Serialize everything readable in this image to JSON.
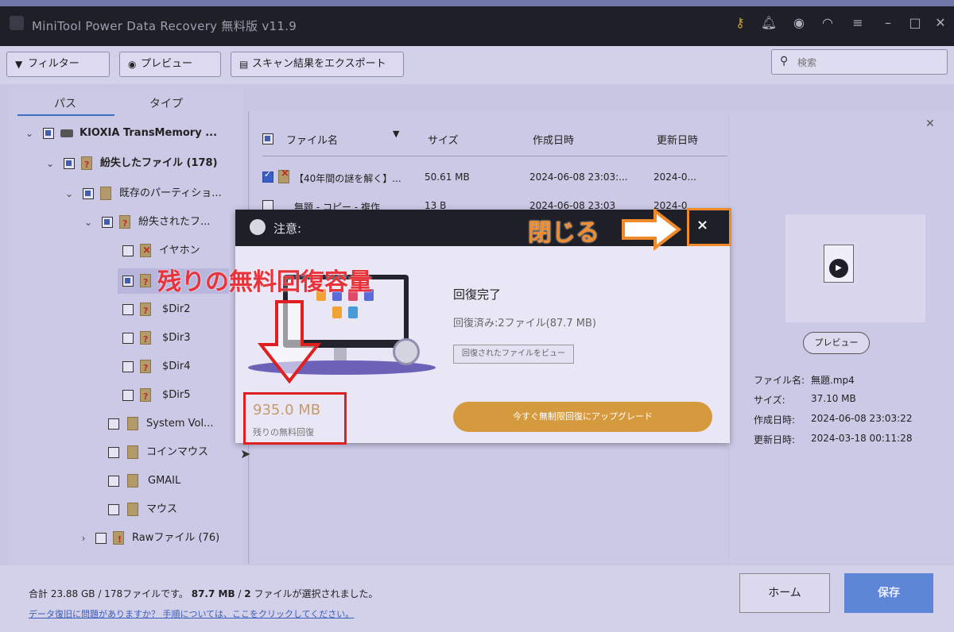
{
  "app": {
    "title": "MiniTool Power Data Recovery 無料版 v11.9",
    "titlebar_icons": [
      "key-icon",
      "bell-icon",
      "disc-icon",
      "headset-icon",
      "menu-icon",
      "minimize-icon",
      "maximize-icon",
      "close-icon"
    ]
  },
  "toolbar": {
    "filter_label": "フィルター",
    "preview_label": "プレビュー",
    "export_label": "スキャン結果をエクスポート",
    "search_placeholder": "検索"
  },
  "left_panel": {
    "tabs": [
      "パス",
      "タイプ"
    ],
    "tree": [
      {
        "label": "KIOXIA TransMemory ...",
        "state": "partial"
      },
      {
        "label": "紛失したファイル (178)",
        "state": "partial"
      },
      {
        "label": "既存のパーティショ...",
        "state": "partial"
      },
      {
        "label": "紛失されたフ...",
        "state": "partial"
      },
      {
        "label": "イヤホン",
        "state": "unchecked"
      },
      {
        "label": "",
        "state": "partial"
      },
      {
        "label": "$Dir2",
        "state": "unchecked"
      },
      {
        "label": "$Dir3",
        "state": "unchecked"
      },
      {
        "label": "$Dir4",
        "state": "unchecked"
      },
      {
        "label": "$Dir5",
        "state": "unchecked"
      },
      {
        "label": "System Vol...",
        "state": "unchecked"
      },
      {
        "label": "コインマウス",
        "state": "unchecked"
      },
      {
        "label": "GMAIL",
        "state": "unchecked"
      },
      {
        "label": "マウス",
        "state": "unchecked"
      },
      {
        "label": "Rawファイル (76)",
        "state": "unchecked"
      }
    ]
  },
  "file_list": {
    "columns": [
      "ファイル名",
      "サイズ",
      "作成日時",
      "更新日時"
    ],
    "rows": [
      {
        "name": "【40年間の謎を解く】...",
        "size": "50.61 MB",
        "created": "2024-06-08 23:03:...",
        "modified": "2024-0...",
        "checked": true
      },
      {
        "name": "無題 - コピー - 複作",
        "size": "13 B",
        "created": "2024-06-08 23:03",
        "modified": "2024-0",
        "checked": false
      }
    ]
  },
  "preview_panel": {
    "preview_button": "プレビュー",
    "file_name_label": "ファイル名:",
    "file_name": "無題.mp4",
    "size_label": "サイズ:",
    "size": "37.10 MB",
    "created_label": "作成日時:",
    "created": "2024-06-08 23:03:22",
    "modified_label": "更新日時:",
    "modified": "2024-03-18 00:11:28"
  },
  "bottom": {
    "summary_prefix": "合計 23.88 GB / 178ファイルです。",
    "summary_selected_size": "87.7 MB",
    "summary_middle": " / ",
    "summary_selected_count": "2",
    "summary_suffix": " ファイルが選択されました。",
    "help_link": "データ復旧に問題がありますか？ 手順については、ここをクリックしてください。",
    "home_button": "ホーム",
    "save_button": "保存"
  },
  "dialog": {
    "title": "注意:",
    "close_glyph": "×",
    "remaining_value": "935.0 MB",
    "remaining_label": "残りの無料回復",
    "heading": "回復完了",
    "recovered_text": "回復済み:2ファイル(87.7 MB)",
    "view_button": "回復されたファイルをビュー",
    "upgrade_button": "今すぐ無制限回復にアップグレード"
  },
  "annotations": {
    "close_label": "閉じる",
    "remaining_label": "残りの無料回復容量",
    "orange": "#f08a2a",
    "red": "#e8333a"
  }
}
